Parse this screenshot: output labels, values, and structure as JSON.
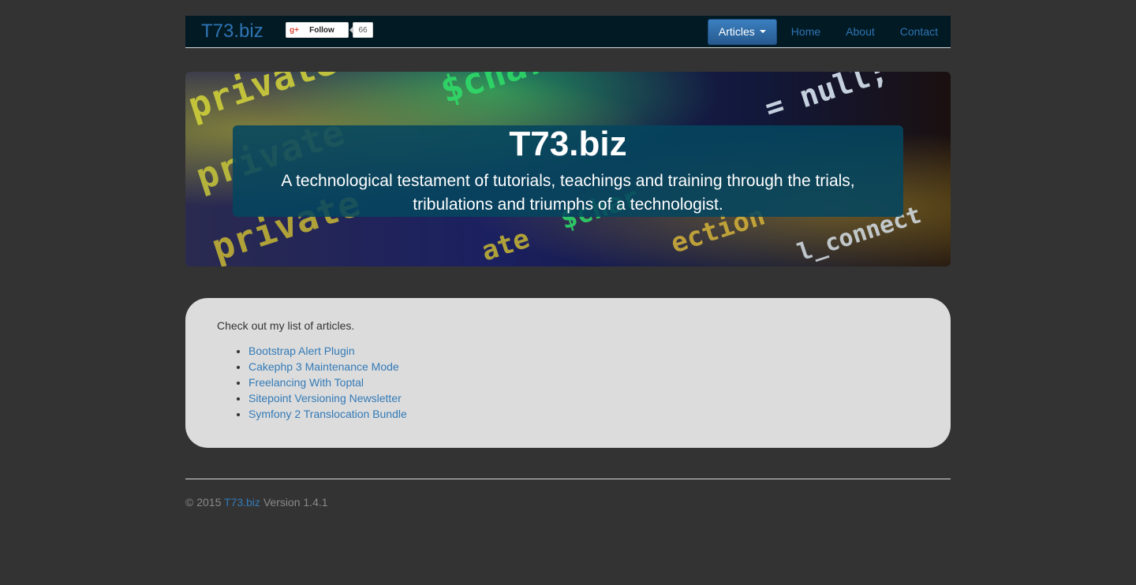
{
  "navbar": {
    "brand": "T73.biz",
    "gplus": {
      "icon": "google-plus-icon",
      "label": "Follow",
      "count": "66"
    },
    "dropdown_label": "Articles",
    "links": [
      "Home",
      "About",
      "Contact"
    ]
  },
  "hero": {
    "title": "T73.biz",
    "subtitle": "A technological testament of tutorials, teachings and training through the trials, tribulations and triumphs of a technologist."
  },
  "content": {
    "intro": "Check out my list of articles.",
    "articles": [
      "Bootstrap Alert Plugin",
      "Cakephp 3 Maintenance Mode",
      "Freelancing With Toptal",
      "Sitepoint Versioning Newsletter",
      "Symfony 2 Translocation Bundle"
    ]
  },
  "footer": {
    "copyright": "© 2015",
    "site_link": "T73.biz",
    "version": "Version 1.4.1"
  },
  "colors": {
    "background": "#333333",
    "navbar": "#011a24",
    "link": "#337ab7",
    "panel": "#dcdcdc",
    "hero_box": "#05465f"
  }
}
